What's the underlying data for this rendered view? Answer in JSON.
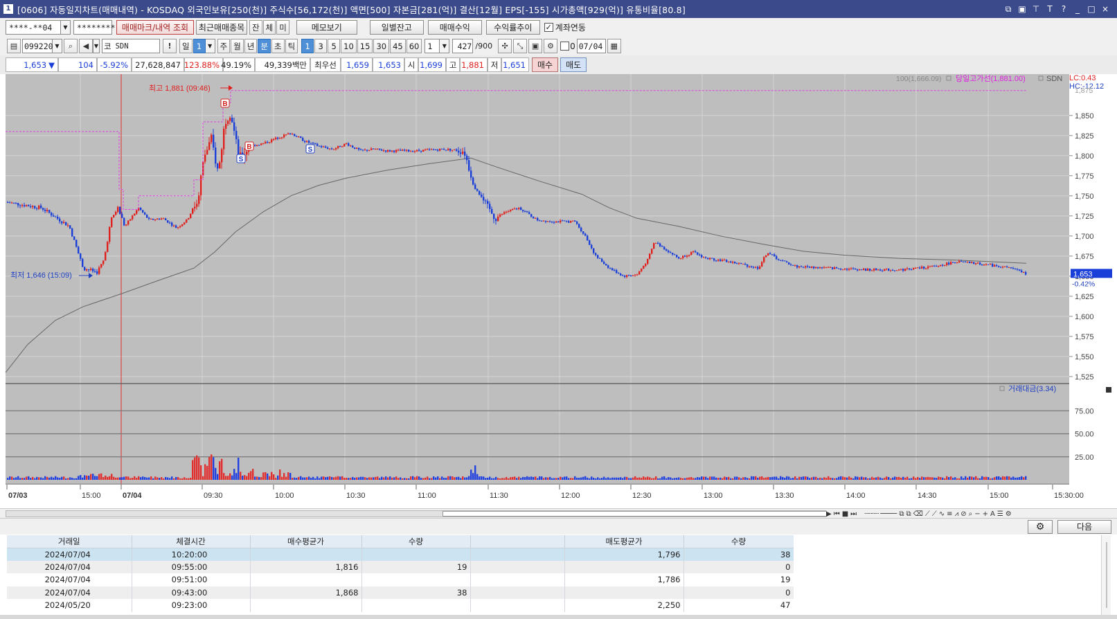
{
  "window": {
    "title": "[0606] 자동일지차트(매매내역) - KOSDAQ 외국인보유[250(천)] 주식수[56,172(천)] 액면[500] 자본금[281(억)] 결산[12월] EPS[-155] 시가총액[929(억)] 유통비율[80.8]",
    "app_icon_label": "1"
  },
  "toolbar1": {
    "account_value": "****-**04",
    "password_value": "********",
    "trade_mark_btn": "매매마크/내역 조회",
    "recent_trades_btn": "최근매매종목",
    "tab_balance": "잔",
    "tab_filled": "체",
    "tab_unfilled": "미",
    "memo_btn": "메모보기",
    "daily_balance_btn": "일별잔고",
    "trade_profit_btn": "매매수익",
    "return_trend_btn": "수익률추이",
    "account_link_checked": true,
    "account_link_check": "✓",
    "account_link_label": "계좌연동"
  },
  "toolbar2": {
    "code_value": "099220",
    "market_label": "코",
    "stock_name": "SDN",
    "period_day": "일",
    "period_num": "1",
    "period_week": "주",
    "period_month": "월",
    "period_year": "년",
    "period_minute": "분",
    "period_second": "초",
    "period_tick": "틱",
    "intervals": [
      "1",
      "3",
      "5",
      "10",
      "15",
      "30",
      "45",
      "60"
    ],
    "interval_select": "1",
    "count_value": "427",
    "count_total": "/900",
    "date_check_label": "0",
    "date_value": "07/04"
  },
  "quote": {
    "price": "1,653",
    "direction": "▼",
    "change": "104",
    "change_pct": "-5.92%",
    "volume": "27,628,847",
    "vol_ratio": "123.88%",
    "turnover": "49.19%",
    "amount": "49,339백만",
    "best_label": "최우선",
    "best_ask": "1,659",
    "best_bid": "1,653",
    "open_label": "시",
    "open": "1,699",
    "high_label": "고",
    "high": "1,881",
    "low_label": "저",
    "low": "1,651",
    "buy_btn": "매수",
    "sell_btn": "매도"
  },
  "chart_data": {
    "type": "candlestick",
    "symbol": "SDN",
    "y_axis_labels": [
      "1,850",
      "1,825",
      "1,800",
      "1,775",
      "1,750",
      "1,725",
      "1,700",
      "1,675",
      "1,650",
      "1,625",
      "1,600",
      "1,575",
      "1,550",
      "1,525"
    ],
    "y_values": [
      1850,
      1825,
      1800,
      1775,
      1750,
      1725,
      1700,
      1675,
      1650,
      1625,
      1600,
      1575,
      1550,
      1525
    ],
    "y_top_partial": "1,875",
    "ylim": [
      1518,
      1886
    ],
    "x_axis_labels": [
      "07/03",
      "15:00",
      "07/04",
      "09:30",
      "10:00",
      "10:30",
      "11:00",
      "11:30",
      "12:00",
      "12:30",
      "13:00",
      "13:30",
      "14:00",
      "14:30",
      "15:00",
      "15:30:00"
    ],
    "high_annotation": "최고 1,881 (09:46)",
    "low_annotation": "최저 1,646 (15:09)",
    "ma_legend": "100(1,666.09)",
    "prev_high_legend": "당일고가선(1,881.00)",
    "symbol_legend": "SDN",
    "lc_label": "LC:0.43",
    "hc_label": "HC:-12.12",
    "current_price_label": "1,653",
    "current_pct_label": "-0.42%",
    "volume_panel_legend": "거래대금(3.34)",
    "volume_axis_labels": [
      "75.00",
      "50.00",
      "25.00"
    ],
    "volume_axis_values": [
      75,
      50,
      25
    ],
    "volume_ylim": [
      0,
      100
    ],
    "prev_close": 1757,
    "day_high": 1881,
    "day_low": 1646,
    "trade_marks": [
      {
        "type": "B",
        "time": "09:43",
        "price": 1868
      },
      {
        "type": "B",
        "time": "09:55",
        "price": 1816
      },
      {
        "type": "S",
        "time": "09:51",
        "price": 1786
      },
      {
        "type": "S",
        "time": "10:20",
        "price": 1796
      }
    ],
    "colors": {
      "up": "#e0201c",
      "down": "#1a3fd8",
      "ma": "#666666",
      "high_line": "#e040e0",
      "current": "#1a3fd8"
    }
  },
  "chart_tools": {
    "icons": [
      "play-next-icon",
      "skip-start-icon",
      "stop-icon",
      "skip-end-icon"
    ],
    "a_label": "A"
  },
  "grid": {
    "gear_label": "⚙",
    "next_btn": "다음",
    "columns": [
      "거래일",
      "체결시간",
      "매수평균가",
      "수량",
      "",
      "매도평균가",
      "수량"
    ],
    "rows": [
      [
        "2024/07/04",
        "10:20:00",
        "",
        "",
        "",
        "1,796",
        "38"
      ],
      [
        "2024/07/04",
        "09:55:00",
        "1,816",
        "19",
        "",
        "",
        "0"
      ],
      [
        "2024/07/04",
        "09:51:00",
        "",
        "",
        "",
        "1,786",
        "19"
      ],
      [
        "2024/07/04",
        "09:43:00",
        "1,868",
        "38",
        "",
        "",
        "0"
      ],
      [
        "2024/05/20",
        "09:23:00",
        "",
        "",
        "",
        "2,250",
        "47"
      ]
    ]
  }
}
